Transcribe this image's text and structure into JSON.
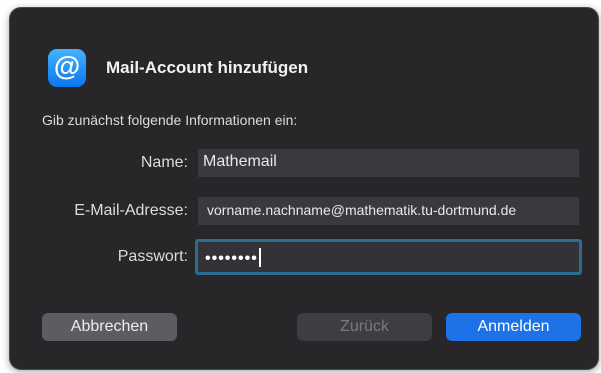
{
  "dialog": {
    "title": "Mail-Account hinzufügen",
    "subtitle": "Gib zunächst folgende Informationen ein:",
    "app_icon": {
      "name": "at-sign-icon",
      "glyph": "@"
    }
  },
  "form": {
    "name": {
      "label": "Name:",
      "value": "Mathemail"
    },
    "email": {
      "label": "E-Mail-Adresse:",
      "value": "vorname.nachname@mathematik.tu-dortmund.de"
    },
    "password": {
      "label": "Passwort:",
      "masked_value": "••••••••"
    }
  },
  "buttons": {
    "cancel": "Abbrechen",
    "back": "Zurück",
    "login": "Anmelden"
  },
  "colors": {
    "dialog_bg": "#282629",
    "accent": "#1c72e6",
    "focus_ring": "#2e6b90"
  }
}
